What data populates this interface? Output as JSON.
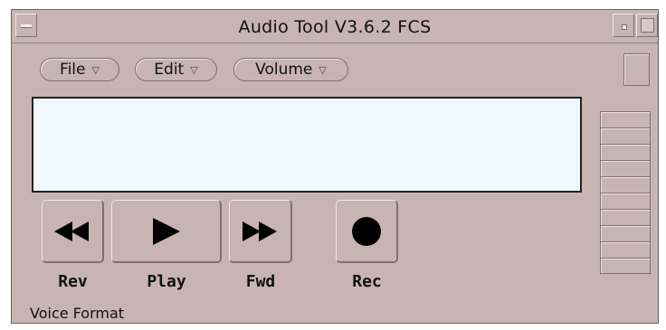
{
  "window": {
    "title": "Audio Tool V3.6.2 FCS"
  },
  "menus": [
    {
      "label": "File"
    },
    {
      "label": "Edit"
    },
    {
      "label": "Volume"
    }
  ],
  "menu_caret": "▽",
  "transport": {
    "rev_label": "Rev",
    "play_label": "Play",
    "fwd_label": "Fwd",
    "rec_label": "Rec"
  },
  "status": {
    "text": "Voice Format"
  },
  "icons": {
    "rev": "rewind-icon",
    "play": "play-icon",
    "fwd": "fast-forward-icon",
    "rec": "record-icon"
  },
  "colors": {
    "window_bg": "#c8b4b2",
    "display_bg": "#eef8fd"
  }
}
